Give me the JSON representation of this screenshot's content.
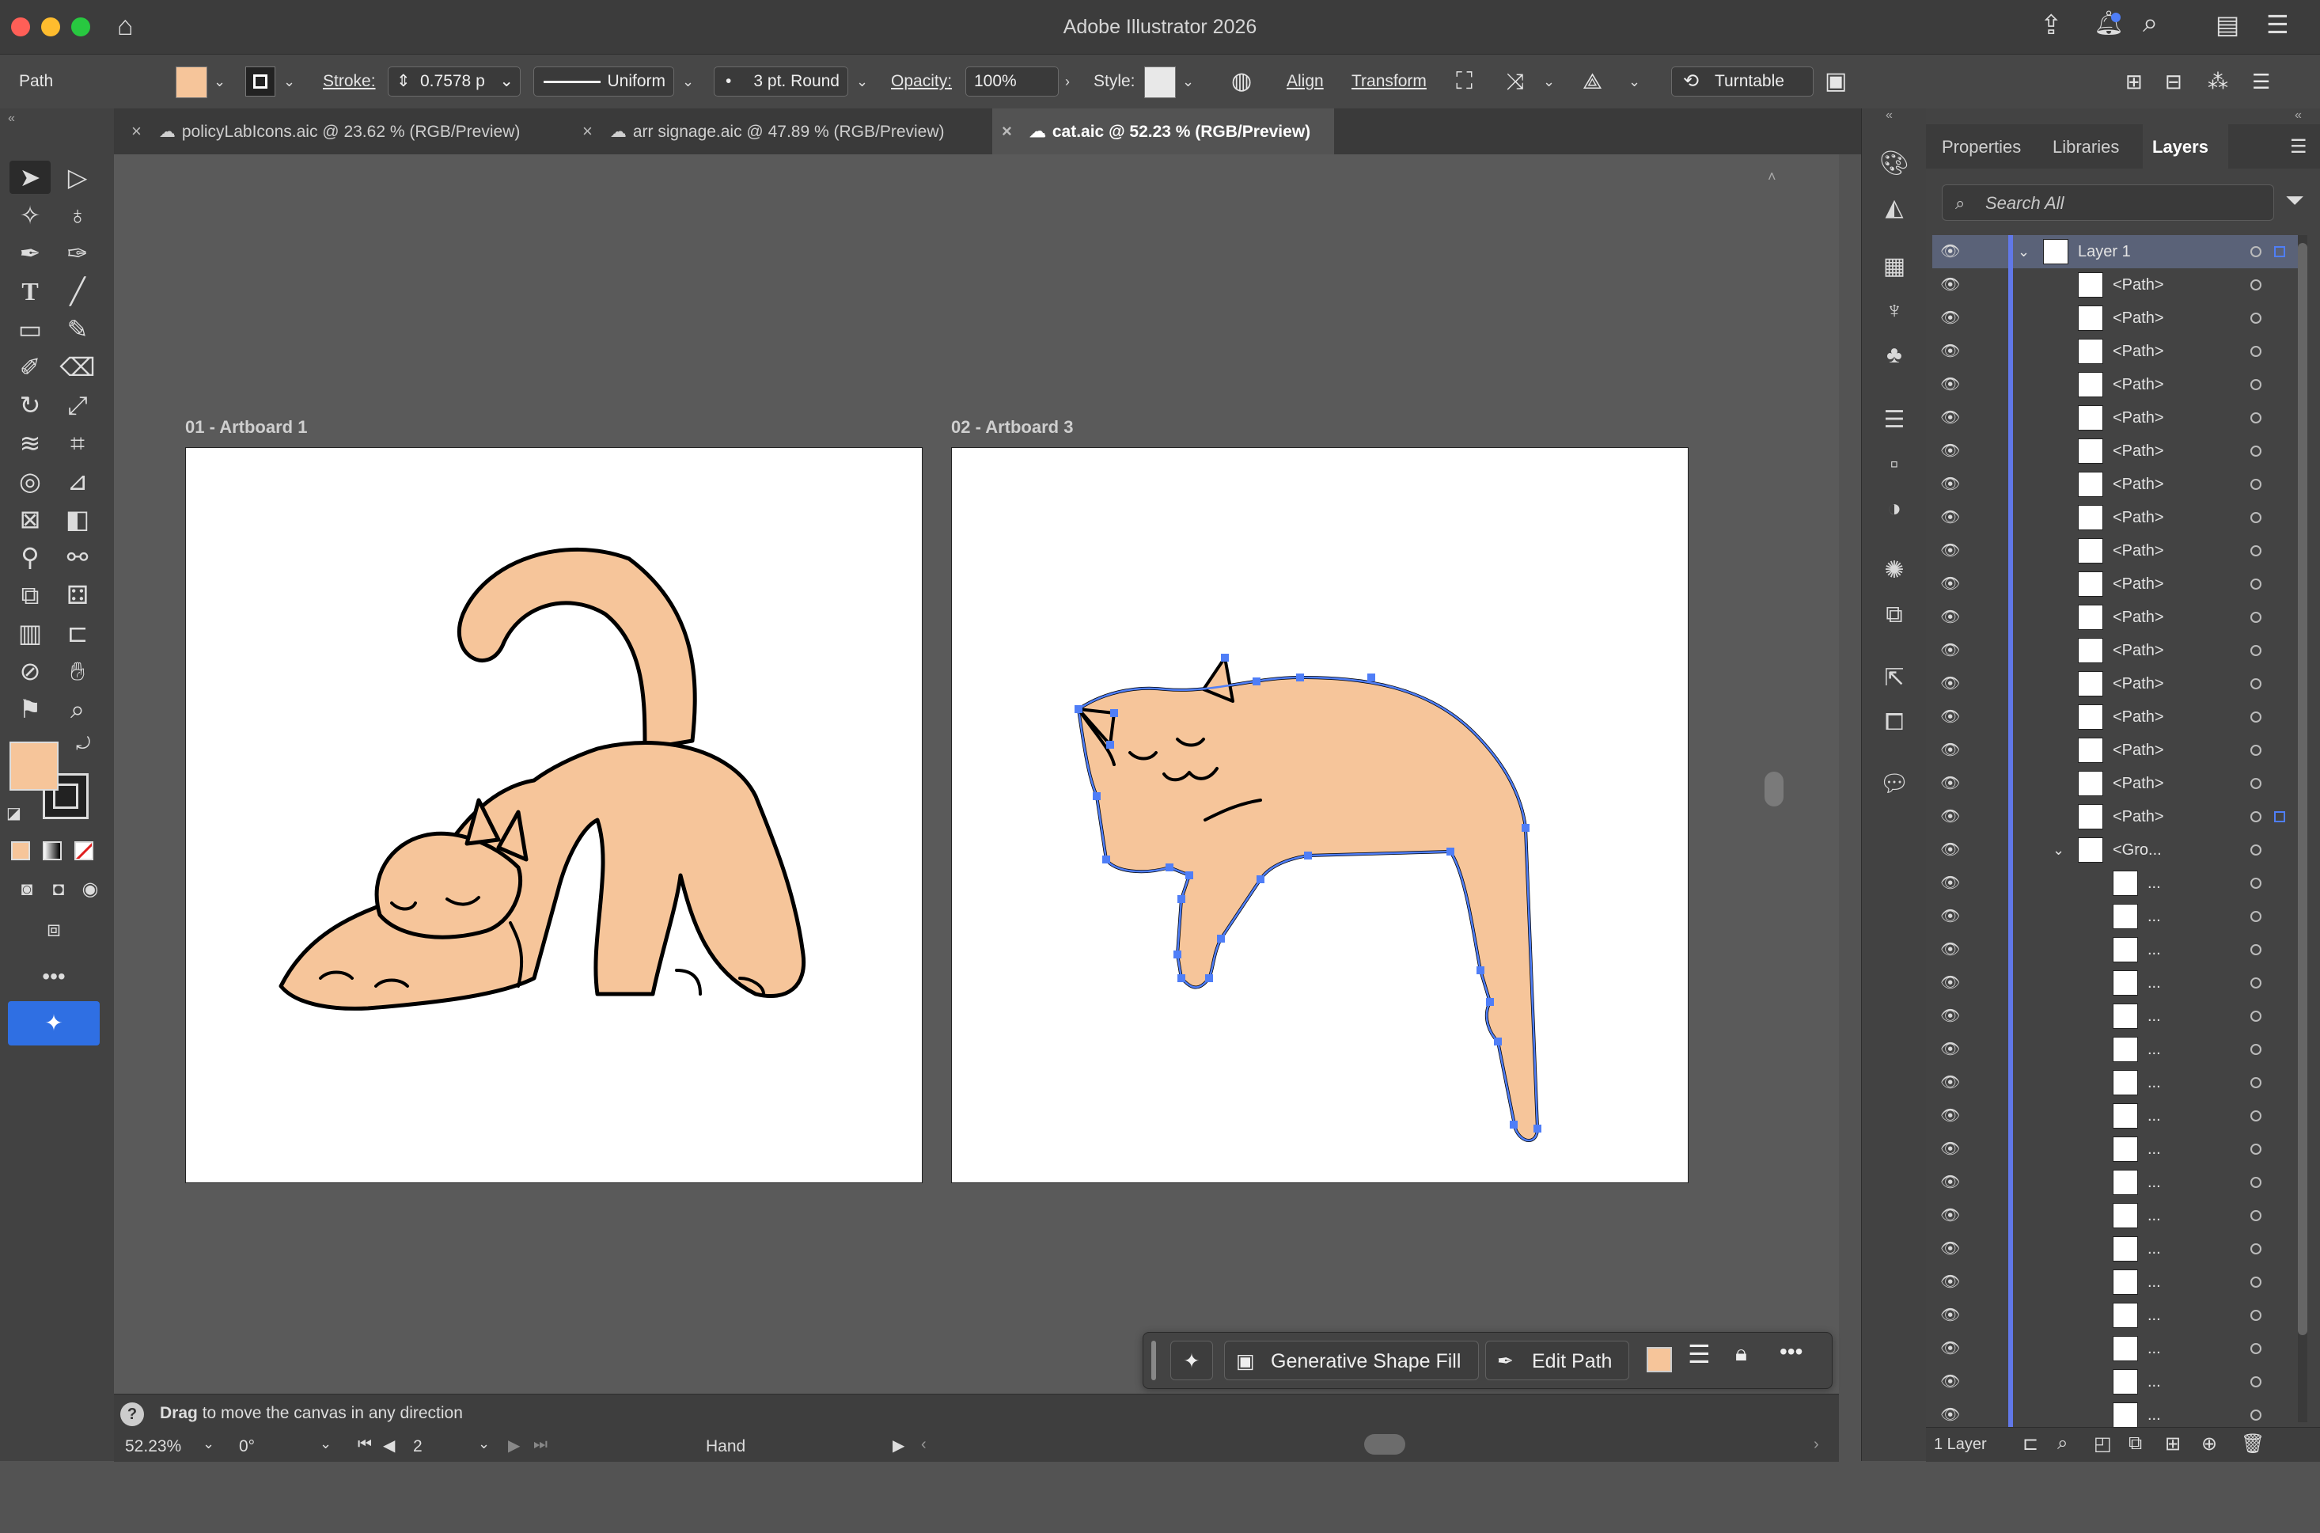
{
  "app": {
    "title": "Adobe Illustrator 2026"
  },
  "control_bar": {
    "selection_type": "Path",
    "fill_color": "#f6c59a",
    "stroke_label": "Stroke:",
    "stroke_weight": "0.7578 p",
    "profile": "Uniform",
    "brush": "3 pt. Round",
    "opacity_label": "Opacity:",
    "opacity": "100%",
    "style_label": "Style:",
    "align": "Align",
    "transform": "Transform",
    "turntable": "Turntable"
  },
  "tabs": [
    {
      "label": "policyLabIcons.aic @ 23.62 % (RGB/Preview)",
      "active": false
    },
    {
      "label": "arr signage.aic @ 47.89 % (RGB/Preview)",
      "active": false
    },
    {
      "label": "cat.aic @ 52.23 % (RGB/Preview)",
      "active": true
    }
  ],
  "artboards": [
    {
      "label": "01 - Artboard 1"
    },
    {
      "label": "02 - Artboard 3"
    }
  ],
  "colors": {
    "cat_fill": "#f6c59a",
    "selection": "#4f7ef7",
    "accent_button": "#2f6fe3"
  },
  "panel": {
    "tabs": [
      "Properties",
      "Libraries",
      "Layers"
    ],
    "active_tab": "Layers",
    "search_placeholder": "Search All",
    "layer_name": "Layer 1",
    "paths": [
      "<Path>",
      "<Path>",
      "<Path>",
      "<Path>",
      "<Path>",
      "<Path>",
      "<Path>",
      "<Path>",
      "<Path>",
      "<Path>",
      "<Path>",
      "<Path>",
      "<Path>",
      "<Path>",
      "<Path>",
      "<Path>",
      "<Path>"
    ],
    "group_name": "<Gro...",
    "group_children": [
      "...",
      "...",
      "...",
      "...",
      "...",
      "...",
      "...",
      "...",
      "...",
      "...",
      "...",
      "...",
      "...",
      "...",
      "...",
      "...",
      "..."
    ],
    "footer_count": "1 Layer"
  },
  "status": {
    "help_bold": "Drag",
    "help_text": "to move the canvas in any direction",
    "zoom": "52.23%",
    "rotation": "0°",
    "artboard_num": "2",
    "tool": "Hand"
  },
  "context_bar": {
    "generative": "Generative Shape Fill",
    "edit_path": "Edit Path"
  }
}
